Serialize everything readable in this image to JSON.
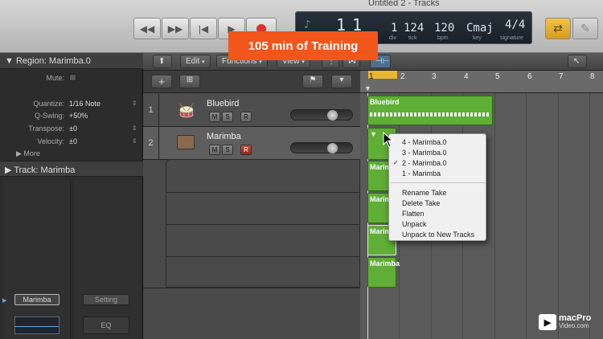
{
  "window": {
    "title": "Untitled 2 - Tracks"
  },
  "promo": {
    "label": "105 min of Training"
  },
  "lcd": {
    "bar": "1",
    "beat": "1",
    "div": "1",
    "tick": "124",
    "tempo": "120",
    "key": "Cmaj",
    "signature": "4/4",
    "div_label": "div",
    "tick_label": "tick",
    "bpm_label": "bpm",
    "key_label": "key",
    "signature_label": "signature"
  },
  "inspector": {
    "region_title": "Region: Marimba.0",
    "rows": [
      {
        "label": "Mute:",
        "value": ""
      },
      {
        "label": "Quantize:",
        "value": "1/16 Note"
      },
      {
        "label": "Q-Swing:",
        "value": "+50%"
      },
      {
        "label": "Transpose:",
        "value": "±0"
      },
      {
        "label": "Velocity:",
        "value": "±0"
      }
    ],
    "more": "More",
    "track_title": "Track:  Marimba",
    "channel_name": "Marimba",
    "setting": "Setting",
    "eq": "EQ"
  },
  "toolbar": {
    "edit": "Edit",
    "functions": "Functions",
    "view": "View"
  },
  "tracks": [
    {
      "number": "1",
      "name": "Bluebird",
      "m": "M",
      "s": "S",
      "r": "R"
    },
    {
      "number": "2",
      "name": "Marimba",
      "m": "M",
      "s": "S",
      "r": "R"
    }
  ],
  "ruler": [
    "1",
    "2",
    "3",
    "4",
    "5",
    "6",
    "7",
    "8"
  ],
  "regions": {
    "bluebird": "Bluebird",
    "marimba": "Marimba"
  },
  "context_menu": {
    "takes": [
      "4 - Marimba.0",
      "3 - Marimba.0",
      "2 - Marimba.0",
      "1 - Marimba"
    ],
    "actions": [
      "Rename Take",
      "Delete Take",
      "Flatten",
      "Unpack",
      "Unpack to New Tracks"
    ]
  },
  "logo": {
    "line1": "macPro",
    "line2": "Video.com"
  },
  "colors": {
    "region_green": "#5fae36",
    "promo_orange": "#f2561b",
    "record_red": "#d9332b",
    "cycle_yellow": "#e8b633"
  }
}
